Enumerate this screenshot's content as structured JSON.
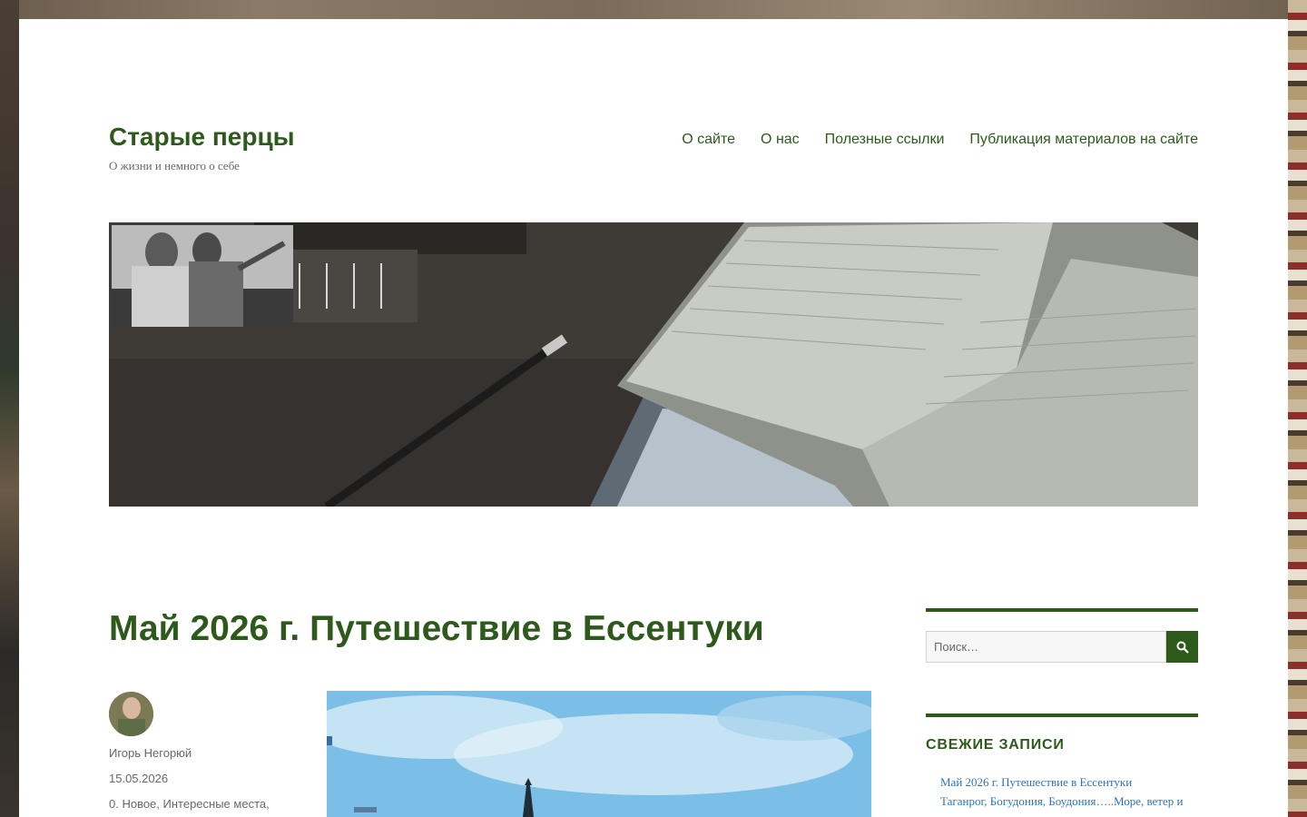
{
  "site": {
    "title": "Старые перцы",
    "description": "О жизни и немного о себе"
  },
  "nav": {
    "items": [
      {
        "label": "О сайте"
      },
      {
        "label": "О нас"
      },
      {
        "label": "Полезные ссылки"
      },
      {
        "label": "Публикация материалов на сайте"
      }
    ]
  },
  "post": {
    "title": "Май 2026 г. Путешествие в Ессентуки",
    "author": "Игорь Негорюй",
    "date": "15.05.2026",
    "categories": "0. Новое, Интересные места,"
  },
  "sidebar": {
    "search": {
      "placeholder": "Поиск…",
      "icon": "search-icon"
    },
    "recent": {
      "title": "СВЕЖИЕ ЗАПИСИ",
      "items": [
        {
          "label": "Май 2026 г. Путешествие в Ессентуки"
        },
        {
          "label": "Таганрог, Богудония, Боудония…..Море, ветер и"
        }
      ]
    }
  },
  "colors": {
    "accent": "#2d5a1b",
    "link": "#2e74b5",
    "meta_text": "#686868"
  }
}
